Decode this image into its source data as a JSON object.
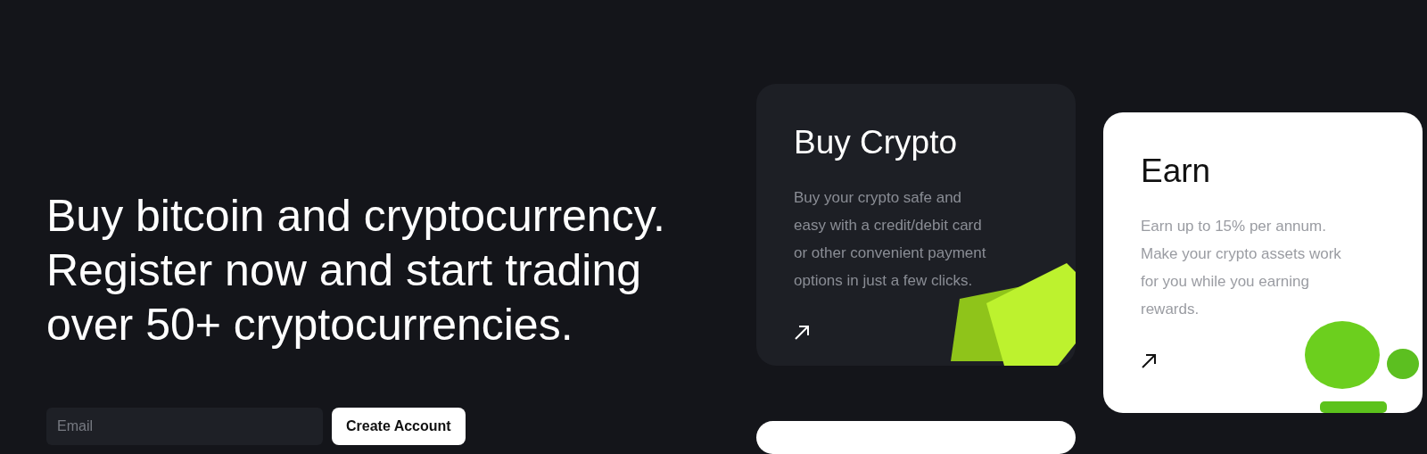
{
  "hero": {
    "headline": "Buy bitcoin and cryptocurrency. Register now and start trading over 50+ cryptocurrencies.",
    "email": {
      "placeholder": "Email"
    },
    "button": "Create Account"
  },
  "cards": [
    {
      "kind": "cards",
      "dark": true,
      "title": "Buy Crypto",
      "description": "Buy your crypto safe and easy with a credit/debit card or other convenient payment options in just a few clicks."
    },
    {
      "kind": "coins",
      "dark": false,
      "title": "Earn",
      "description": "Earn up to 15% per annum. Make your crypto assets work for you while you earning rewards."
    }
  ]
}
